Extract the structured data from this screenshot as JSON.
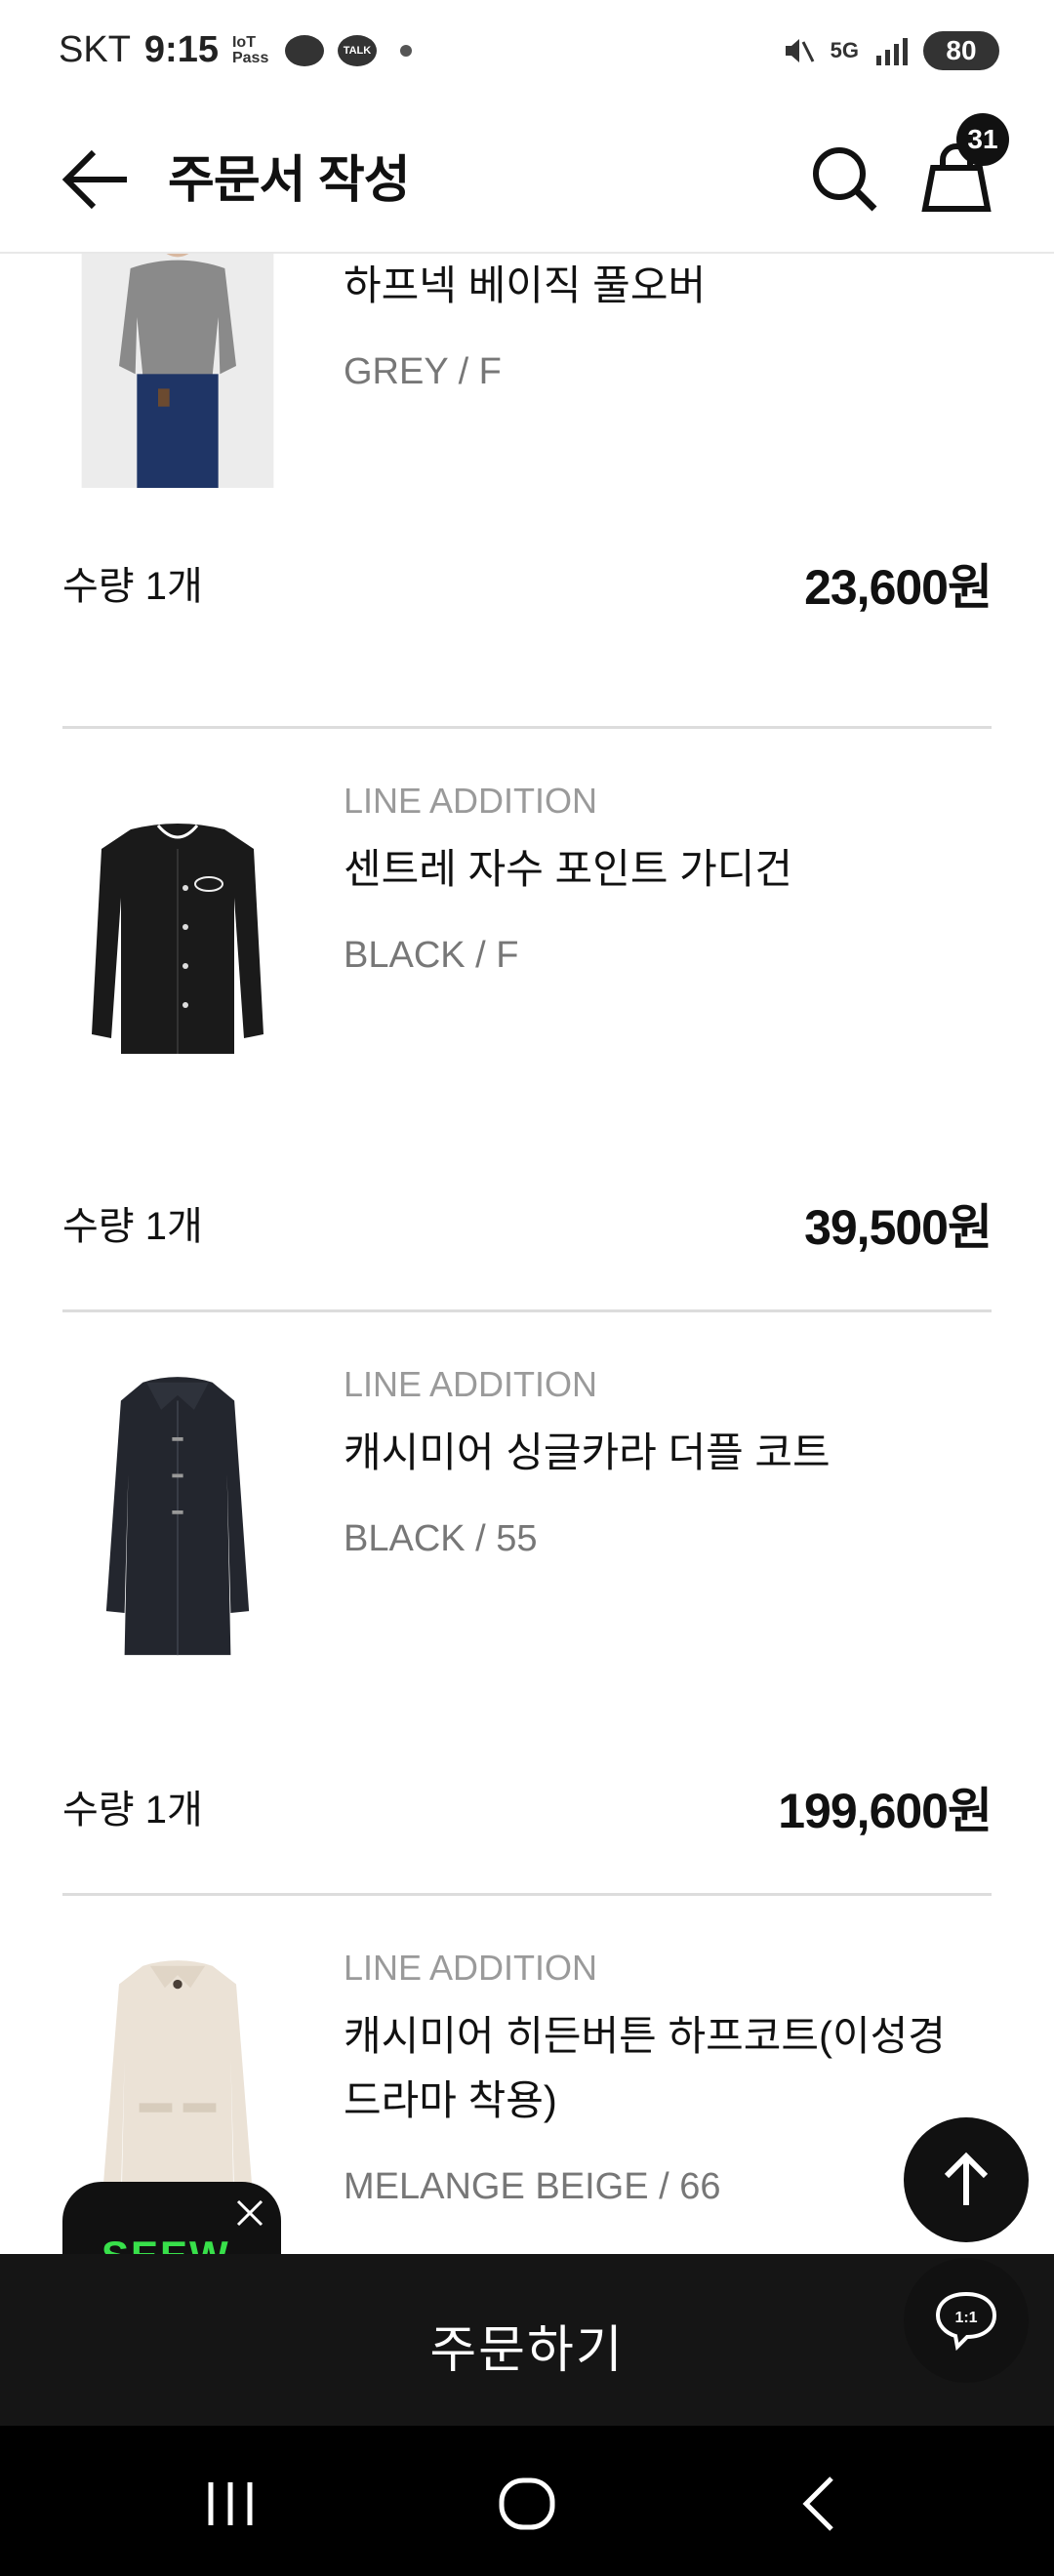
{
  "status_bar": {
    "carrier": "SKT",
    "time": "9:15",
    "iot_pass": "IoT Pass",
    "talk": "TALK",
    "network": "5G",
    "battery": "80"
  },
  "header": {
    "title": "주문서 작성",
    "cart_count": "31"
  },
  "items": [
    {
      "brand": "",
      "name": "하프넥 베이직 풀오버",
      "option": "GREY / F",
      "qty": "수량 1개",
      "price": "23,600원"
    },
    {
      "brand": "LINE ADDITION",
      "name": "센트레 자수 포인트 가디건",
      "option": "BLACK / F",
      "qty": "수량 1개",
      "price": "39,500원"
    },
    {
      "brand": "LINE ADDITION",
      "name": "캐시미어 싱글카라 더플 코트",
      "option": "BLACK / 55",
      "qty": "수량 1개",
      "price": "199,600원"
    },
    {
      "brand": "LINE ADDITION",
      "name": "캐시미어 히든버튼 하프코트(이성경 드라마 착용)",
      "option": "MELANGE BEIGE / 66",
      "qty": "",
      "price": ""
    }
  ],
  "promo": {
    "text": "SEEW"
  },
  "order_button": {
    "label": "주문하기"
  },
  "chat": {
    "label": "1:1"
  },
  "colors": {
    "background": "#ffffff",
    "dark": "#151515",
    "muted_text": "#9a9a9a",
    "promo_green": "#38e04a"
  }
}
